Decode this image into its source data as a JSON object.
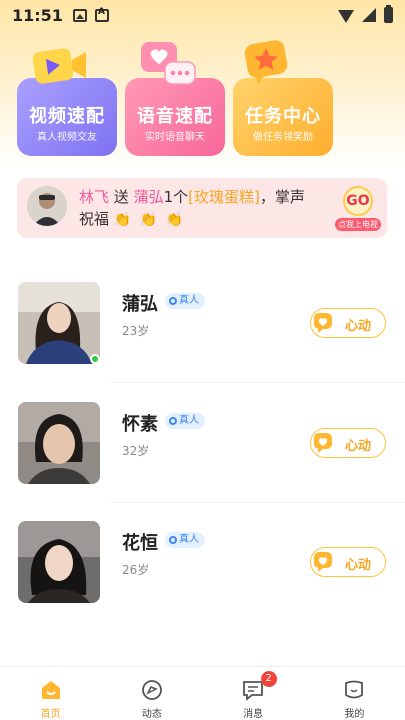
{
  "status_bar": {
    "time": "11:51"
  },
  "features": [
    {
      "title": "视频速配",
      "subtitle": "真人视频交友",
      "icon": "video-camera-icon"
    },
    {
      "title": "语音速配",
      "subtitle": "实时语音聊天",
      "icon": "chat-bubble-icon"
    },
    {
      "title": "任务中心",
      "subtitle": "做任务领奖励",
      "icon": "star-bubble-icon"
    }
  ],
  "banner": {
    "sender": "林飞",
    "send_word": "送",
    "receiver": "蒲弘",
    "count": "1个",
    "gift": "[玫瑰蛋糕]",
    "suffix": "，掌声",
    "line2": "祝福",
    "claps": "👏 👏 👏",
    "go_label": "GO",
    "go_sub": "点我上电视"
  },
  "users": [
    {
      "name": "蒲弘",
      "badge": "真人",
      "age": "23岁",
      "button": "心动",
      "online": true
    },
    {
      "name": "怀素",
      "badge": "真人",
      "age": "32岁",
      "button": "心动",
      "online": false
    },
    {
      "name": "花恒",
      "badge": "真人",
      "age": "26岁",
      "button": "心动",
      "online": false
    }
  ],
  "nav": [
    {
      "label": "首页",
      "icon": "home-icon",
      "active": true
    },
    {
      "label": "动态",
      "icon": "moments-icon",
      "active": false
    },
    {
      "label": "消息",
      "icon": "message-icon",
      "active": false,
      "badge": "2"
    },
    {
      "label": "我的",
      "icon": "profile-icon",
      "active": false
    }
  ],
  "colors": {
    "accent": "#f6a623",
    "pink": "#f05a9a",
    "video_card": "#8f83f5",
    "voice_card": "#f9719f",
    "task_card": "#ffbb3c"
  }
}
